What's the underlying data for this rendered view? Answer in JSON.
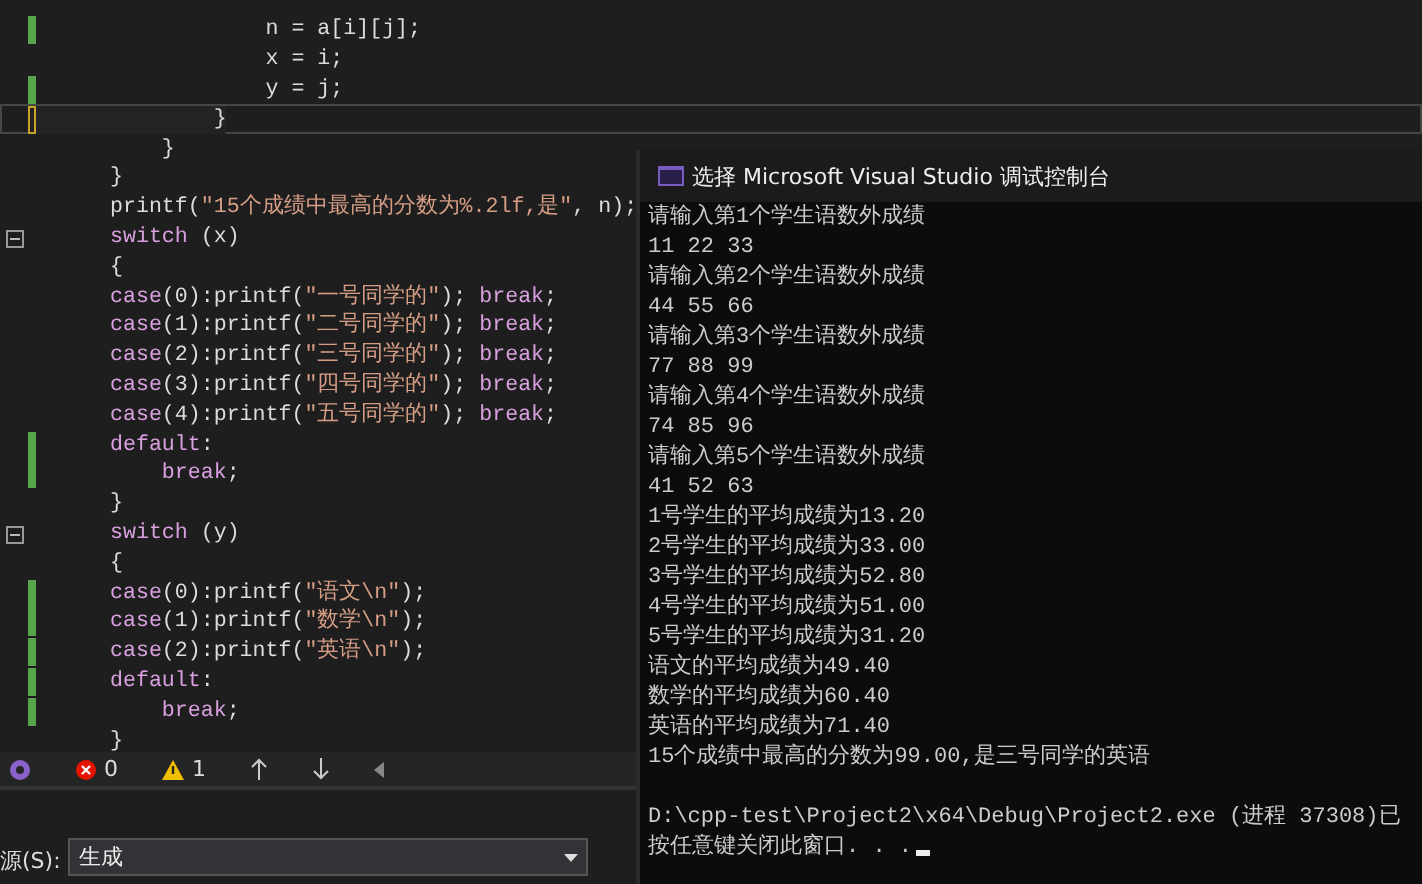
{
  "editor": {
    "lines": [
      {
        "modified": true,
        "unsaved": false,
        "current": false,
        "tokens": [
          {
            "kind": "plain",
            "text": "            n = a[i][j];"
          }
        ]
      },
      {
        "modified": false,
        "unsaved": false,
        "current": false,
        "tokens": [
          {
            "kind": "plain",
            "text": "            x = i;"
          }
        ]
      },
      {
        "modified": true,
        "unsaved": false,
        "current": false,
        "tokens": [
          {
            "kind": "plain",
            "text": "            y = j;"
          }
        ]
      },
      {
        "modified": false,
        "unsaved": true,
        "current": true,
        "tokens": [
          {
            "kind": "plain",
            "text": "        }"
          }
        ]
      },
      {
        "modified": false,
        "unsaved": false,
        "current": false,
        "tokens": [
          {
            "kind": "plain",
            "text": "    }"
          }
        ]
      },
      {
        "modified": false,
        "unsaved": false,
        "current": false,
        "tokens": [
          {
            "kind": "plain",
            "text": "}"
          }
        ]
      },
      {
        "modified": false,
        "unsaved": false,
        "current": false,
        "tokens": [
          {
            "kind": "plain",
            "text": "printf("
          },
          {
            "kind": "string",
            "text": "\"15个成绩中最高的分数为%.2lf,是\""
          },
          {
            "kind": "plain",
            "text": ", n);"
          }
        ]
      },
      {
        "modified": false,
        "unsaved": false,
        "current": false,
        "foldable": true,
        "tokens": [
          {
            "kind": "keyword",
            "text": "switch"
          },
          {
            "kind": "plain",
            "text": " (x)"
          }
        ]
      },
      {
        "modified": false,
        "unsaved": false,
        "current": false,
        "tokens": [
          {
            "kind": "plain",
            "text": "{"
          }
        ]
      },
      {
        "modified": false,
        "unsaved": false,
        "current": false,
        "tokens": [
          {
            "kind": "keyword",
            "text": "case"
          },
          {
            "kind": "plain",
            "text": "(0):printf("
          },
          {
            "kind": "string",
            "text": "\"一号同学的\""
          },
          {
            "kind": "plain",
            "text": "); "
          },
          {
            "kind": "keyword",
            "text": "break"
          },
          {
            "kind": "plain",
            "text": ";"
          }
        ]
      },
      {
        "modified": false,
        "unsaved": false,
        "current": false,
        "tokens": [
          {
            "kind": "keyword",
            "text": "case"
          },
          {
            "kind": "plain",
            "text": "(1):printf("
          },
          {
            "kind": "string",
            "text": "\"二号同学的\""
          },
          {
            "kind": "plain",
            "text": "); "
          },
          {
            "kind": "keyword",
            "text": "break"
          },
          {
            "kind": "plain",
            "text": ";"
          }
        ]
      },
      {
        "modified": false,
        "unsaved": false,
        "current": false,
        "tokens": [
          {
            "kind": "keyword",
            "text": "case"
          },
          {
            "kind": "plain",
            "text": "(2):printf("
          },
          {
            "kind": "string",
            "text": "\"三号同学的\""
          },
          {
            "kind": "plain",
            "text": "); "
          },
          {
            "kind": "keyword",
            "text": "break"
          },
          {
            "kind": "plain",
            "text": ";"
          }
        ]
      },
      {
        "modified": false,
        "unsaved": false,
        "current": false,
        "tokens": [
          {
            "kind": "keyword",
            "text": "case"
          },
          {
            "kind": "plain",
            "text": "(3):printf("
          },
          {
            "kind": "string",
            "text": "\"四号同学的\""
          },
          {
            "kind": "plain",
            "text": "); "
          },
          {
            "kind": "keyword",
            "text": "break"
          },
          {
            "kind": "plain",
            "text": ";"
          }
        ]
      },
      {
        "modified": false,
        "unsaved": false,
        "current": false,
        "tokens": [
          {
            "kind": "keyword",
            "text": "case"
          },
          {
            "kind": "plain",
            "text": "(4):printf("
          },
          {
            "kind": "string",
            "text": "\"五号同学的\""
          },
          {
            "kind": "plain",
            "text": "); "
          },
          {
            "kind": "keyword",
            "text": "break"
          },
          {
            "kind": "plain",
            "text": ";"
          }
        ]
      },
      {
        "modified": true,
        "unsaved": false,
        "current": false,
        "tokens": [
          {
            "kind": "keyword",
            "text": "default"
          },
          {
            "kind": "plain",
            "text": ":"
          }
        ]
      },
      {
        "modified": true,
        "unsaved": false,
        "current": false,
        "tokens": [
          {
            "kind": "keyword",
            "text": "    break"
          },
          {
            "kind": "plain",
            "text": ";"
          }
        ]
      },
      {
        "modified": false,
        "unsaved": false,
        "current": false,
        "tokens": [
          {
            "kind": "plain",
            "text": "}"
          }
        ]
      },
      {
        "modified": false,
        "unsaved": false,
        "current": false,
        "foldable": true,
        "tokens": [
          {
            "kind": "keyword",
            "text": "switch"
          },
          {
            "kind": "plain",
            "text": " (y)"
          }
        ]
      },
      {
        "modified": false,
        "unsaved": false,
        "current": false,
        "tokens": [
          {
            "kind": "plain",
            "text": "{"
          }
        ]
      },
      {
        "modified": true,
        "unsaved": false,
        "current": false,
        "tokens": [
          {
            "kind": "keyword",
            "text": "case"
          },
          {
            "kind": "plain",
            "text": "(0):printf("
          },
          {
            "kind": "string",
            "text": "\"语文\\n\""
          },
          {
            "kind": "plain",
            "text": ");"
          }
        ]
      },
      {
        "modified": true,
        "unsaved": false,
        "current": false,
        "tokens": [
          {
            "kind": "keyword",
            "text": "case"
          },
          {
            "kind": "plain",
            "text": "(1):printf("
          },
          {
            "kind": "string",
            "text": "\"数学\\n\""
          },
          {
            "kind": "plain",
            "text": ");"
          }
        ]
      },
      {
        "modified": true,
        "unsaved": false,
        "current": false,
        "tokens": [
          {
            "kind": "keyword",
            "text": "case"
          },
          {
            "kind": "plain",
            "text": "(2):printf("
          },
          {
            "kind": "string",
            "text": "\"英语\\n\""
          },
          {
            "kind": "plain",
            "text": ");"
          }
        ]
      },
      {
        "modified": true,
        "unsaved": false,
        "current": false,
        "tokens": [
          {
            "kind": "keyword",
            "text": "default"
          },
          {
            "kind": "plain",
            "text": ":"
          }
        ]
      },
      {
        "modified": true,
        "unsaved": false,
        "current": false,
        "tokens": [
          {
            "kind": "keyword",
            "text": "    break"
          },
          {
            "kind": "plain",
            "text": ";"
          }
        ]
      },
      {
        "modified": false,
        "unsaved": false,
        "current": false,
        "tokens": [
          {
            "kind": "plain",
            "text": "}"
          }
        ]
      }
    ]
  },
  "status_bar": {
    "errors": "0",
    "warnings": "1"
  },
  "output_panel": {
    "source_label": "源(S):",
    "source_value": "生成"
  },
  "console": {
    "title": "选择 Microsoft Visual Studio 调试控制台",
    "lines": [
      "请输入第1个学生语数外成绩",
      "11 22 33",
      "请输入第2个学生语数外成绩",
      "44 55 66",
      "请输入第3个学生语数外成绩",
      "77 88 99",
      "请输入第4个学生语数外成绩",
      "74 85 96",
      "请输入第5个学生语数外成绩",
      "41 52 63",
      "1号学生的平均成绩为13.20",
      "2号学生的平均成绩为33.00",
      "3号学生的平均成绩为52.80",
      "4号学生的平均成绩为51.00",
      "5号学生的平均成绩为31.20",
      "语文的平均成绩为49.40",
      "数学的平均成绩为60.40",
      "英语的平均成绩为71.40",
      "15个成绩中最高的分数为99.00,是三号同学的英语"
    ],
    "exit_lines": [
      "D:\\cpp-test\\Project2\\x64\\Debug\\Project2.exe (进程 37308)已",
      "按任意键关闭此窗口. . ."
    ],
    "cursor": true
  }
}
